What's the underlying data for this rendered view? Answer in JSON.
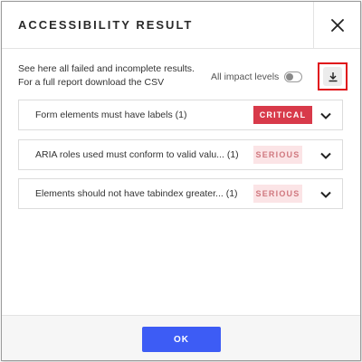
{
  "dialog": {
    "title": "ACCESSIBILITY RESULT",
    "intro_line1": "See here all failed and incomplete results.",
    "intro_line2": "For a full report download the CSV",
    "impact_toggle_label": "All impact levels",
    "impact_toggle_on": false
  },
  "icons": {
    "close": "close-icon",
    "download": "download-icon",
    "chevron": "chevron-down-icon"
  },
  "results": [
    {
      "text": "Form elements must have labels (1)",
      "badge": "CRITICAL"
    },
    {
      "text": "ARIA roles used must conform to valid valu... (1)",
      "badge": "SERIOUS"
    },
    {
      "text": "Elements should not have tabindex greater... (1)",
      "badge": "SERIOUS"
    }
  ],
  "footer": {
    "ok_label": "OK"
  },
  "colors": {
    "critical_bg": "#d83a4a",
    "serious_bg": "#fbe4e6",
    "serious_text": "#d0787f",
    "primary_button": "#3d5cf5",
    "highlight_border": "#e0121a"
  }
}
